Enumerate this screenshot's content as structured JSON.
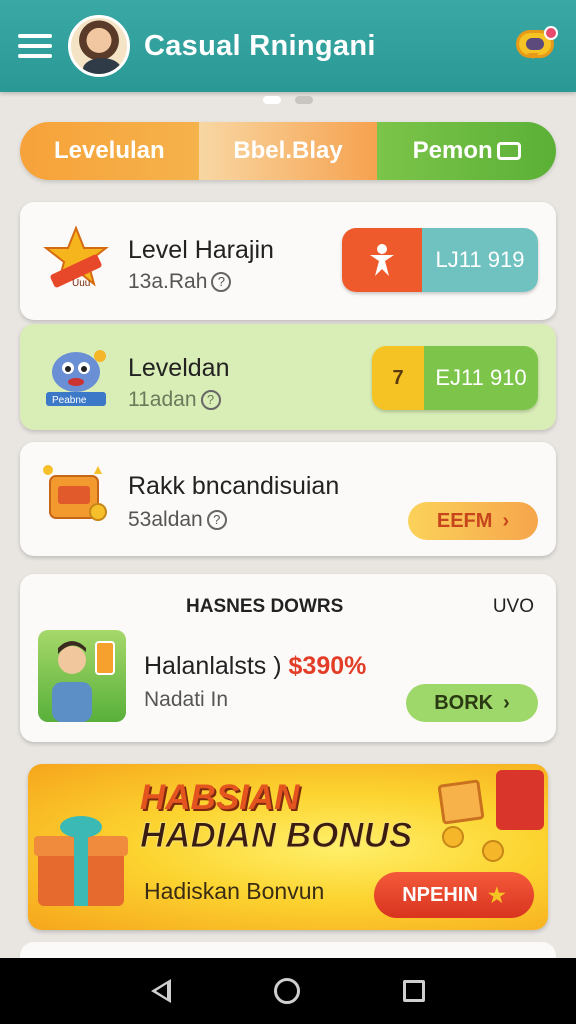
{
  "header": {
    "title": "Casual Rningani"
  },
  "page_indicator": {
    "count": 2,
    "active": 1
  },
  "tabs": [
    {
      "label": "Levelulan"
    },
    {
      "label": "Bbel.Blay"
    },
    {
      "label": "Pemon"
    }
  ],
  "cards": [
    {
      "title": "Level Harajin",
      "subtitle": "13a.Rah",
      "badge_left": "",
      "badge_right": "LJ11 919",
      "icon_label": "Uuu"
    },
    {
      "title": "Leveldan",
      "subtitle": "11adan",
      "badge_left": "7",
      "badge_right": "EJ11 910",
      "icon_label": "Peabne"
    },
    {
      "title": "Rakk bncandisuian",
      "subtitle": "53aldan",
      "button_label": "EEFM"
    }
  ],
  "offer_card": {
    "header_left": "HASNES DOWRS",
    "header_right": "UVO",
    "title": "Halanlalsts )",
    "highlight": "$390%",
    "subtitle": "Nadati In",
    "button_label": "BORK"
  },
  "banner": {
    "headline_1": "HABSIAN",
    "headline_2": "HADIAN BONUS",
    "subtitle": "Hadiskan Bonvun",
    "button_label": "NPEHIN"
  },
  "colors": {
    "header": "#2a9894",
    "orange": "#f4743b",
    "green": "#7cc44a",
    "yellow": "#f6c324",
    "teal": "#6fc2c0"
  }
}
